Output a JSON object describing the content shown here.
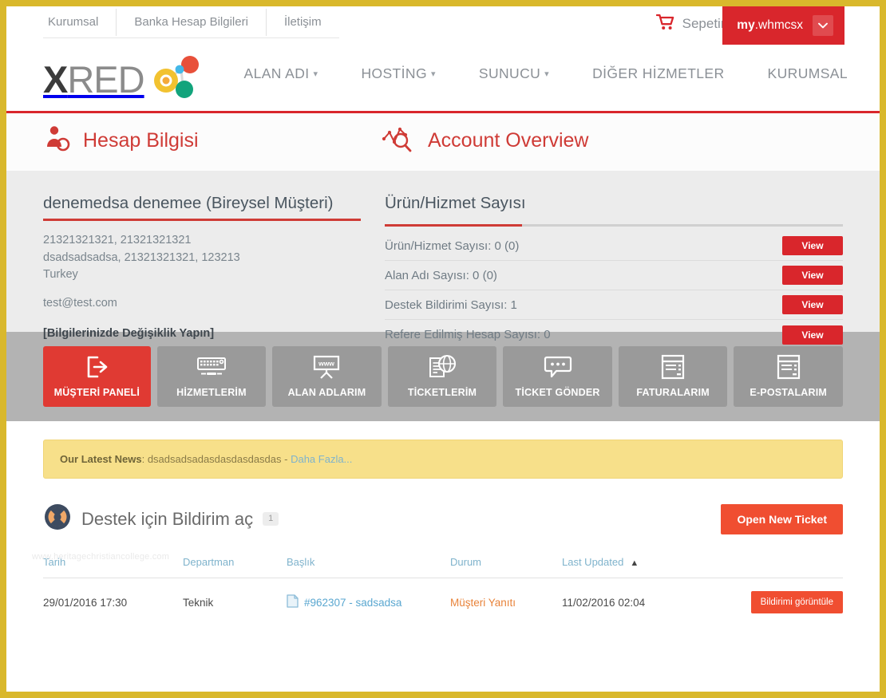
{
  "topbar": {
    "links": [
      {
        "label": "Kurumsal"
      },
      {
        "label": "Banka Hesap Bilgileri"
      },
      {
        "label": "İletişim"
      }
    ],
    "cart_label": "Sepetim",
    "cart_icon": "shopping-cart-icon",
    "account_name_bold": "my",
    "account_name_rest": ".whmcsx",
    "account_caret_icon": "chevron-down-icon"
  },
  "brand": {
    "logo_x": "X",
    "logo_red": "RED",
    "dot_colors": {
      "yellow": "#f2c230",
      "red": "#e8503a",
      "green": "#12a47c",
      "blue": "#44b8e8"
    }
  },
  "mainnav": {
    "items": [
      {
        "label": "ALAN ADI",
        "caret": true
      },
      {
        "label": "HOSTİNG",
        "caret": true
      },
      {
        "label": "SUNUCU",
        "caret": true
      },
      {
        "label": "DİĞER HİZMETLER",
        "caret": false
      },
      {
        "label": "KURUMSAL",
        "caret": false
      }
    ]
  },
  "section_headers": {
    "left": {
      "title": "Hesap Bilgisi",
      "icon": "user-gear-icon"
    },
    "right": {
      "title": "Account Overview",
      "icon": "chart-magnifier-icon"
    }
  },
  "account": {
    "title": "denemedsa denemee (Bireysel Müşteri)",
    "address_lines": [
      "21321321321, 21321321321",
      "dsadsadsadsa, 21321321321, 123213",
      "Turkey"
    ],
    "email": "test@test.com",
    "change_link": "[Bilgilerinizde Değişiklik Yapın]"
  },
  "overview": {
    "title": "Ürün/Hizmet Sayısı",
    "view_label": "View",
    "rows": [
      {
        "label": "Ürün/Hizmet Sayısı: 0 (0)"
      },
      {
        "label": "Alan Adı Sayısı: 0 (0)"
      },
      {
        "label": "Destek Bildirimi Sayısı: 1"
      },
      {
        "label": "Refere Edilmiş Hesap Sayısı: 0"
      }
    ]
  },
  "tiles": [
    {
      "label": "MÜŞTERİ PANELİ",
      "icon": "logout-arrow-icon",
      "active": true
    },
    {
      "label": "HİZMETLERİM",
      "icon": "keyboard-icon",
      "active": false
    },
    {
      "label": "ALAN ADLARIM",
      "icon": "www-board-icon",
      "active": false
    },
    {
      "label": "TİCKETLERİM",
      "icon": "globe-document-icon",
      "active": false
    },
    {
      "label": "TİCKET GÖNDER",
      "icon": "speech-bubble-icon",
      "active": false
    },
    {
      "label": "FATURALARIM",
      "icon": "invoice-icon",
      "active": false
    },
    {
      "label": "E-POSTALARIM",
      "icon": "invoice-icon",
      "active": false
    }
  ],
  "news": {
    "label": "Our Latest News",
    "separator": ": ",
    "text": "dsadsadsadasdasdasdasdas",
    "dash": " - ",
    "link": "Daha Fazla..."
  },
  "tickets": {
    "section_title": "Destek için Bildirim aç",
    "section_icon": "lifebuoy-icon",
    "count_badge": "1",
    "open_button": "Open New Ticket",
    "columns": [
      "Tarih",
      "Departman",
      "Başlık",
      "Durum",
      "Last Updated"
    ],
    "sort_column": "Last Updated",
    "sort_caret": "▲",
    "rows": [
      {
        "date": "29/01/2016 17:30",
        "department": "Teknik",
        "subject": "#962307 - sadsadsa",
        "subject_icon": "document-icon",
        "status": "Müşteri Yanıtı",
        "last_updated": "11/02/2016 02:04",
        "action": "Bildirimi görüntüle"
      }
    ]
  },
  "watermark": "www.heritagechristiancollege.com",
  "colors": {
    "brand_red": "#d9262c",
    "accent_orange": "#f04e31",
    "frame_gold": "#d9b82c",
    "panel_gray": "#ececec",
    "tiles_gray": "#b3b3b3"
  }
}
